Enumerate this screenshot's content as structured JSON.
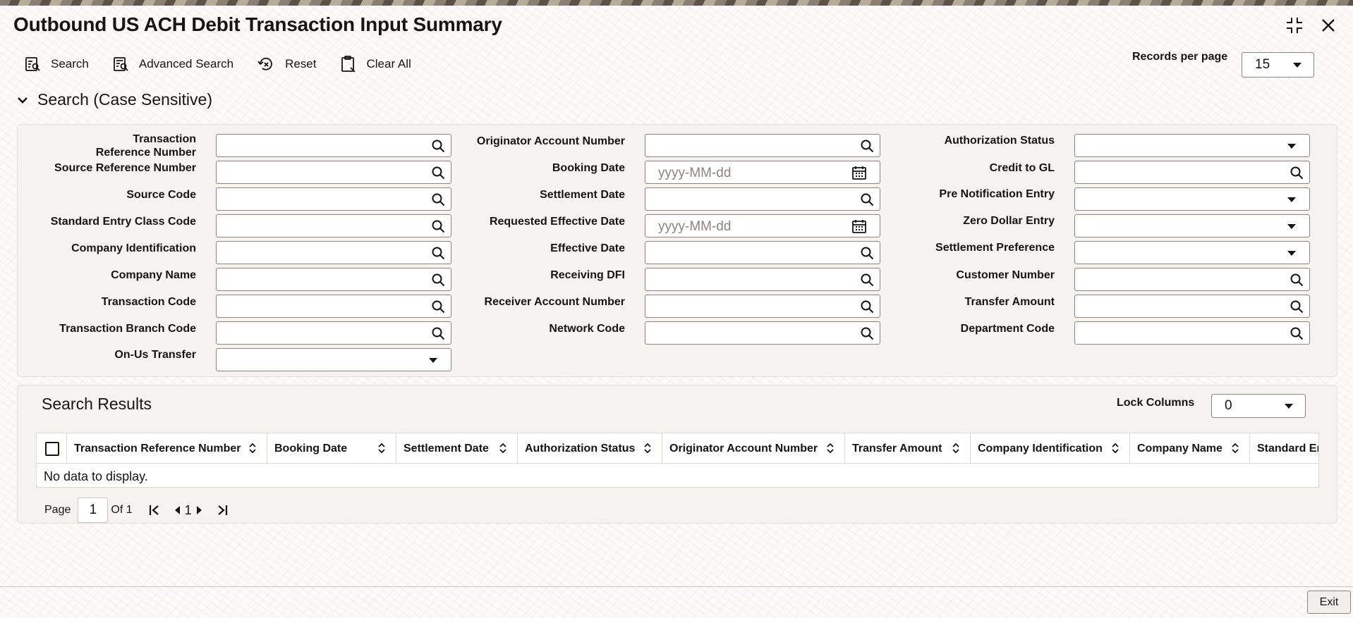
{
  "window": {
    "title": "Outbound US ACH Debit Transaction Input Summary"
  },
  "toolbar": {
    "search_label": "Search",
    "advanced_search_label": "Advanced Search",
    "reset_label": "Reset",
    "clear_all_label": "Clear All",
    "records_per_page_label": "Records per page",
    "records_per_page_value": "15"
  },
  "search_section": {
    "title": "Search (Case Sensitive)",
    "col1": [
      {
        "label": "Transaction Reference Number",
        "type": "lookup"
      },
      {
        "label": "Source Reference Number",
        "type": "lookup"
      },
      {
        "label": "Source Code",
        "type": "lookup"
      },
      {
        "label": "Standard Entry Class Code",
        "type": "lookup"
      },
      {
        "label": "Company Identification",
        "type": "lookup"
      },
      {
        "label": "Company Name",
        "type": "lookup"
      },
      {
        "label": "Transaction Code",
        "type": "lookup"
      },
      {
        "label": "Transaction Branch Code",
        "type": "lookup"
      },
      {
        "label": "On-Us Transfer",
        "type": "select"
      }
    ],
    "col2": [
      {
        "label": "Originator Account Number",
        "type": "lookup"
      },
      {
        "label": "Booking Date",
        "type": "date",
        "placeholder": "yyyy-MM-dd"
      },
      {
        "label": "Settlement Date",
        "type": "lookup"
      },
      {
        "label": "Requested Effective Date",
        "type": "date",
        "placeholder": "yyyy-MM-dd"
      },
      {
        "label": "Effective Date",
        "type": "lookup"
      },
      {
        "label": "Receiving DFI",
        "type": "lookup"
      },
      {
        "label": "Receiver Account Number",
        "type": "lookup"
      },
      {
        "label": "Network Code",
        "type": "lookup"
      }
    ],
    "col3": [
      {
        "label": "Authorization Status",
        "type": "select"
      },
      {
        "label": "Credit to GL",
        "type": "lookup"
      },
      {
        "label": "Pre Notification Entry",
        "type": "select"
      },
      {
        "label": "Zero Dollar Entry",
        "type": "select"
      },
      {
        "label": "Settlement Preference",
        "type": "select"
      },
      {
        "label": "Customer Number",
        "type": "lookup"
      },
      {
        "label": "Transfer Amount",
        "type": "lookup"
      },
      {
        "label": "Department Code",
        "type": "lookup"
      }
    ]
  },
  "results": {
    "title": "Search Results",
    "lock_columns_label": "Lock Columns",
    "lock_columns_value": "0",
    "columns": [
      "Transaction Reference Number",
      "Booking Date",
      "Settlement Date",
      "Authorization Status",
      "Originator Account Number",
      "Transfer Amount",
      "Company Identification",
      "Company Name",
      "Standard Ent"
    ],
    "empty_message": "No data to display."
  },
  "pagination": {
    "page_label": "Page",
    "page_value": "1",
    "of_label": "Of 1",
    "current": "1"
  },
  "footer": {
    "exit_label": "Exit"
  },
  "colors": {
    "panel_bg": "#f5f3f0",
    "border": "#8b8680",
    "text": "#161513"
  }
}
